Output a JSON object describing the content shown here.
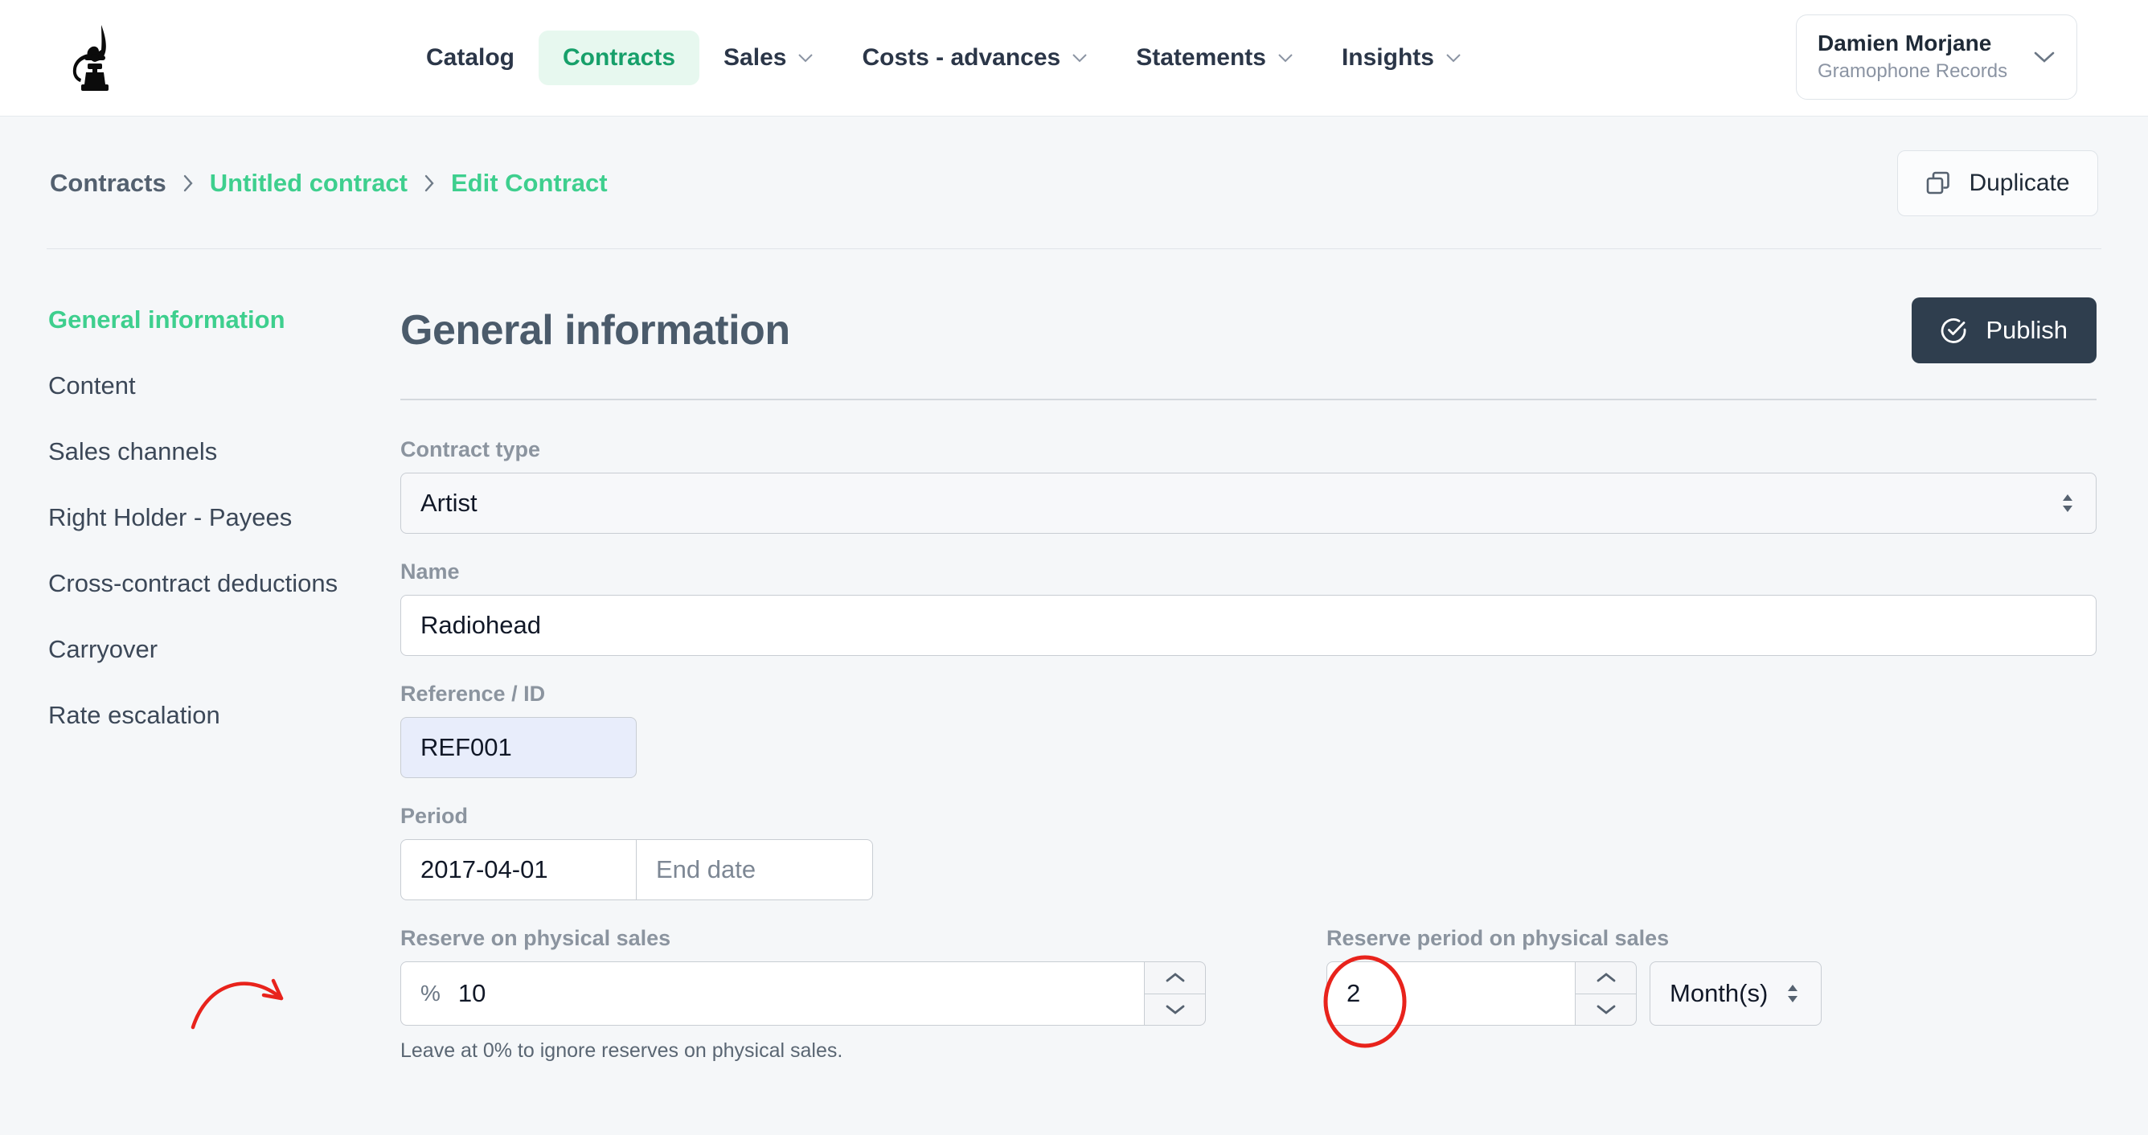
{
  "topnav": {
    "logo_icon": "gramophone-logo",
    "items": [
      {
        "label": "Catalog",
        "has_caret": false,
        "active": false
      },
      {
        "label": "Contracts",
        "has_caret": false,
        "active": true
      },
      {
        "label": "Sales",
        "has_caret": true,
        "active": false
      },
      {
        "label": "Costs - advances",
        "has_caret": true,
        "active": false
      },
      {
        "label": "Statements",
        "has_caret": true,
        "active": false
      },
      {
        "label": "Insights",
        "has_caret": true,
        "active": false
      }
    ],
    "user": {
      "name": "Damien Morjane",
      "org": "Gramophone Records",
      "caret_icon": "chevron-down-icon"
    },
    "active_color": "#17a06a",
    "active_bg": "#e7f8ef"
  },
  "breadcrumb": {
    "items": [
      {
        "label": "Contracts",
        "green": false
      },
      {
        "label": "Untitled contract",
        "green": true
      },
      {
        "label": "Edit Contract",
        "green": true
      }
    ],
    "separator_icon": "chevron-right-icon",
    "green": "#3ecf8e"
  },
  "duplicate_button": {
    "label": "Duplicate",
    "icon": "copy-icon"
  },
  "sidebar": {
    "items": [
      {
        "label": "General information",
        "active": true
      },
      {
        "label": "Content",
        "active": false
      },
      {
        "label": "Sales channels",
        "active": false
      },
      {
        "label": "Right Holder - Payees",
        "active": false
      },
      {
        "label": "Cross-contract deductions",
        "active": false
      },
      {
        "label": "Carryover",
        "active": false
      },
      {
        "label": "Rate escalation",
        "active": false
      }
    ]
  },
  "main": {
    "title": "General information",
    "publish_button": {
      "label": "Publish",
      "icon": "circle-check-icon",
      "bg": "#2f3e4e"
    },
    "fields": {
      "contract_type": {
        "label": "Contract type",
        "value": "Artist",
        "control": "select"
      },
      "name": {
        "label": "Name",
        "value": "Radiohead",
        "control": "text"
      },
      "reference": {
        "label": "Reference / ID",
        "value": "REF001",
        "control": "text",
        "bg": "#e8edfb"
      },
      "period": {
        "label": "Period",
        "start_value": "2017-04-01",
        "end_value": "",
        "end_placeholder": "End date"
      },
      "reserve_on_physical_sales": {
        "label": "Reserve on physical sales",
        "prefix": "%",
        "value": "10",
        "hint": "Leave at 0% to ignore reserves on physical sales."
      },
      "reserve_period_on_physical_sales": {
        "label": "Reserve period on physical sales",
        "value": "2",
        "unit": "Month(s)"
      }
    }
  },
  "annotations": {
    "color": "#e8231c",
    "arrow_target": "reserve-on-physical-sales-input",
    "circle_target": "reserve-period-value-input"
  }
}
